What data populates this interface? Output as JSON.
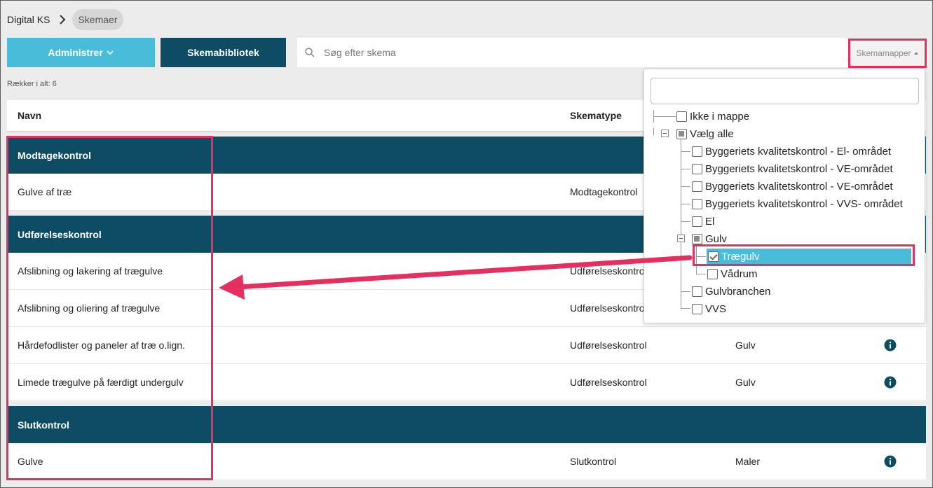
{
  "breadcrumb": {
    "root": "Digital KS",
    "current": "Skemaer"
  },
  "toolbar": {
    "administer_label": "Administrer",
    "library_label": "Skemabibliotek",
    "search_placeholder": "Søg efter skema",
    "folders_label": "Skemamapper"
  },
  "rows_total": "Rækker i alt: 6",
  "table": {
    "headers": {
      "name": "Navn",
      "type": "Skematype"
    },
    "groups": [
      {
        "title": "Modtagekontrol",
        "rows": [
          {
            "name": "Gulve af træ",
            "type": "Modtagekontrol",
            "folder": ""
          }
        ]
      },
      {
        "title": "Udførelseskontrol",
        "rows": [
          {
            "name": "Afslibning og lakering af trægulve",
            "type": "Udførelseskontrol",
            "folder": ""
          },
          {
            "name": "Afslibning og oliering af trægulve",
            "type": "Udførelseskontrol",
            "folder": ""
          },
          {
            "name": "Hårdefodlister og paneler af træ o.lign.",
            "type": "Udførelseskontrol",
            "folder": "Gulv"
          },
          {
            "name": "Limede trægulve på færdigt undergulv",
            "type": "Udførelseskontrol",
            "folder": "Gulv"
          }
        ]
      },
      {
        "title": "Slutkontrol",
        "rows": [
          {
            "name": "Gulve",
            "type": "Slutkontrol",
            "folder": "Maler"
          }
        ]
      }
    ]
  },
  "folder_tree": {
    "items": [
      "Ikke i mappe",
      "Vælg alle",
      "Byggeriets kvalitetskontrol - El- området",
      "Byggeriets kvalitetskontrol - VE-området",
      "Byggeriets kvalitetskontrol - VE-området",
      "Byggeriets kvalitetskontrol - VVS- området",
      "El",
      "Gulv",
      "Trægulv",
      "Vådrum",
      "Gulvbranchen",
      "VVS"
    ]
  },
  "colors": {
    "accent": "#49bcd9",
    "dark": "#0d4c63",
    "highlight": "#e5305f"
  },
  "icons": {
    "info": "info-icon",
    "search": "search-icon"
  }
}
